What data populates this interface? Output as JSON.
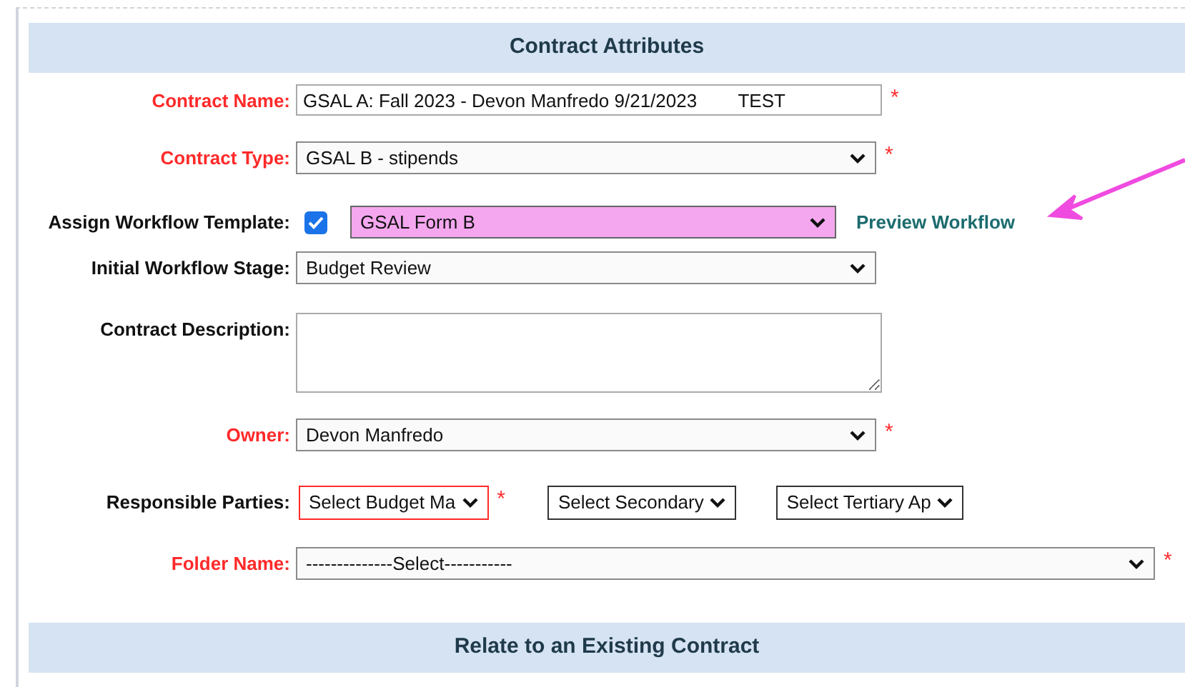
{
  "sections": [
    {
      "title": "Contract Attributes"
    },
    {
      "title": "Relate to an Existing Contract"
    }
  ],
  "fields": [
    {
      "kind": "text",
      "label": "Contract Name:",
      "required": true,
      "star": "*",
      "value": "GSAL A: Fall 2023 - Devon Manfredo 9/21/2023        TEST"
    },
    {
      "kind": "select",
      "label": "Contract Type:",
      "required": true,
      "star": "*",
      "value": "GSAL B - stipends"
    },
    {
      "kind": "template",
      "label": "Assign Workflow Template:",
      "required": false,
      "checked": true,
      "value": "GSAL Form B",
      "highlighted": true,
      "link": "Preview Workflow"
    },
    {
      "kind": "select",
      "label": "Initial Workflow Stage:",
      "required": false,
      "value": "Budget Review"
    },
    {
      "kind": "textarea",
      "label": "Contract Description:",
      "required": false
    },
    {
      "kind": "select",
      "label": "Owner:",
      "required": true,
      "star": "*",
      "value": "Devon Manfredo"
    },
    {
      "kind": "multi",
      "label": "Responsible Parties:",
      "required": false,
      "selects": [
        {
          "value": "Select Budget Ma",
          "required": true,
          "star": "*"
        },
        {
          "value": "Select Secondary",
          "required": false
        },
        {
          "value": "Select Tertiary Ap",
          "required": false
        }
      ]
    },
    {
      "kind": "wide",
      "label": "Folder Name:",
      "required": true,
      "star": "*",
      "value": "--------------Select-----------"
    }
  ],
  "annotation": {
    "kind": "arrow"
  }
}
